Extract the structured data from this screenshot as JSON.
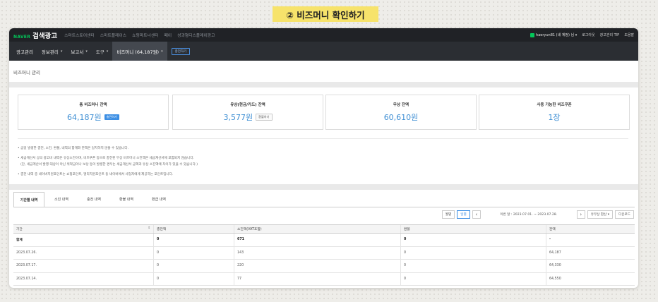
{
  "banner": "② 비즈머니 확인하기",
  "topbar": {
    "logo_naver": "NAVER",
    "logo_title": "검색광고",
    "links": [
      "스마트스토어센터",
      "스마트플레이스",
      "쇼핑파트너센터",
      "페이",
      "성과형디스플레이광고"
    ],
    "user": "haeryun81 (네 계정) 님 ▾",
    "right_links": [
      "로그아웃",
      "광고관리 TIP",
      "도움말"
    ]
  },
  "menu": {
    "items": [
      {
        "label": "광고관리",
        "caret": ""
      },
      {
        "label": "정보관리",
        "caret": "▾"
      },
      {
        "label": "보고서",
        "caret": "▾"
      },
      {
        "label": "도구",
        "caret": "▾"
      },
      {
        "label": "비즈머니 (64,187원)",
        "caret": "▾"
      }
    ],
    "charge_label": "충전하기"
  },
  "breadcrumb": "비즈머니 관리",
  "cards": [
    {
      "title": "총 비즈머니 잔액",
      "value": "64,187원",
      "button": "충전하기"
    },
    {
      "title": "유상(현금/카드) 잔액",
      "value": "3,577원",
      "button": "환불하기"
    },
    {
      "title": "무상 잔액",
      "value": "60,610원",
      "button": ""
    },
    {
      "title": "사용 가능한 비즈쿠폰",
      "value": "1장",
      "button": ""
    }
  ],
  "notes": [
    "• 금일 발생한 충전, 소진, 환불, 내역의 합계와 잔액은 일치하지 않을 수 있습니다.",
    "• 세금계산서 상의 광고비 내역은 유상소진이며, 비즈쿠폰 등으로 충전된 무상 비즈머니 소진액은 세금계산서에 포함되지 않습니다.",
    "(단, 세금계산서 발행 대상이 아닌 위약금이나 보상 등이 발생한 경우는 세금계산서 금액과 유상 소진액에 차이가 있을 수 있습니다.)",
    "• 충전 내역 중 네이버지원포인트는 쇼핑포인트, 멀티지원포인트 등 네이버에서 사업자에게 제공하는 포인트입니다."
  ],
  "tabs": [
    "기간별 내역",
    "소진 내역",
    "충전 내역",
    "환불 내역",
    "환급 내역"
  ],
  "controls": {
    "monthly": "월별",
    "daily": "일별",
    "prev": "‹",
    "period": "이번 달 : 2023.07.01. ~ 2023.07.28.",
    "next": "›",
    "sort": "유무상 합산 ▾",
    "download": "다운로드"
  },
  "table": {
    "headers": [
      "기간",
      "충전액",
      "소진액(VAT포함)",
      "환불",
      "잔액"
    ],
    "sort_icon": "⇕",
    "total": [
      "합계",
      "0",
      "671",
      "0",
      "-"
    ],
    "rows": [
      [
        "2023.07.26.",
        "0",
        "143",
        "0",
        "64,187"
      ],
      [
        "2023.07.17.",
        "0",
        "220",
        "0",
        "64,330"
      ],
      [
        "2023.07.14.",
        "0",
        "77",
        "0",
        "64,550"
      ]
    ]
  }
}
